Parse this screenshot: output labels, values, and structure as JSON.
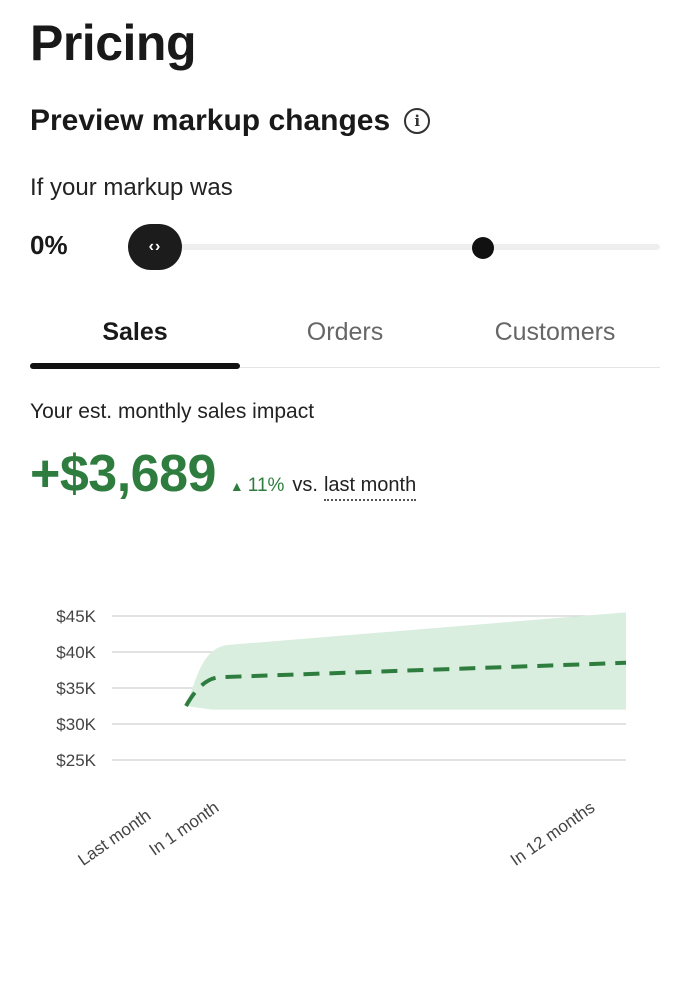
{
  "header": {
    "title": "Pricing"
  },
  "preview": {
    "title": "Preview markup changes",
    "info_icon_glyph": "i",
    "markup_label": "If your markup was",
    "markup_value": "0%",
    "slider_handle_glyph": "‹›"
  },
  "tabs": [
    {
      "label": "Sales",
      "active": true
    },
    {
      "label": "Orders",
      "active": false
    },
    {
      "label": "Customers",
      "active": false
    }
  ],
  "impact": {
    "label": "Your est. monthly sales impact",
    "value": "+$3,689",
    "delta": "11%",
    "vs": "vs.",
    "period": "last month"
  },
  "chart_data": {
    "type": "area",
    "x_labels": [
      "Last month",
      "In 1 month",
      "In 12 months"
    ],
    "y_ticks": [
      "$45K",
      "$40K",
      "$35K",
      "$30K",
      "$25K"
    ],
    "ylim": [
      25,
      45
    ],
    "unit": "$K",
    "series": [
      {
        "type": "line",
        "style": "dashed",
        "points": [
          {
            "x": 0,
            "y": 32.5
          },
          {
            "x": 1,
            "y": 36.5
          },
          {
            "x": 12,
            "y": 38.5
          }
        ]
      },
      {
        "type": "band",
        "upper": [
          {
            "x": 0,
            "y": 32.5
          },
          {
            "x": 1,
            "y": 41
          },
          {
            "x": 12,
            "y": 45.5
          }
        ],
        "lower": [
          {
            "x": 0,
            "y": 32.5
          },
          {
            "x": 1,
            "y": 32
          },
          {
            "x": 12,
            "y": 32
          }
        ]
      }
    ],
    "colors": {
      "line": "#2e7d3f",
      "band": "#d9eede",
      "grid": "#d0d0d0"
    },
    "grid": true
  }
}
